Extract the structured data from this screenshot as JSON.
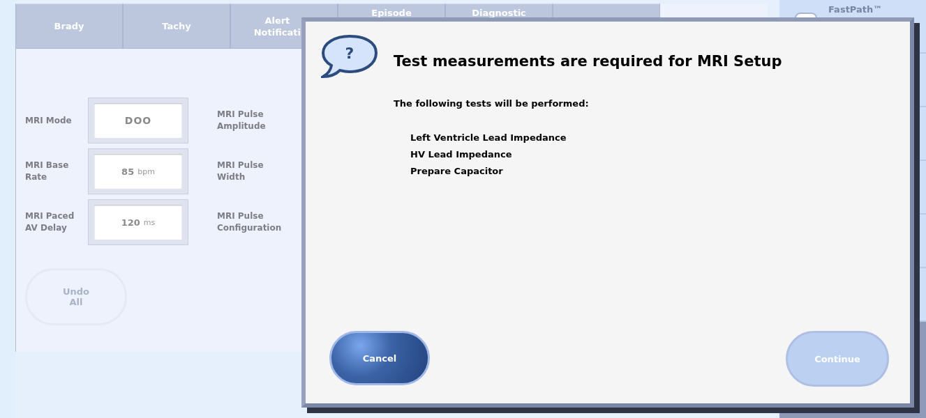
{
  "tabs": [
    {
      "label": "Brady",
      "selected": false
    },
    {
      "label": "Tachy",
      "selected": false
    },
    {
      "label": "Alert Notificati",
      "selected": false
    },
    {
      "label": "Episode",
      "selected": false
    },
    {
      "label": "Diagnostic",
      "selected": false
    },
    {
      "selected": false
    },
    {
      "selected": true
    }
  ],
  "settings": [
    {
      "label": "MRI Mode",
      "value": "DOO",
      "side_label": "MRI Pulse Amplitude"
    },
    {
      "label": "MRI Base Rate",
      "value": "85",
      "unit": "bpm",
      "side_label": "MRI Pulse Width"
    },
    {
      "label": "MRI Paced AV Delay",
      "value": "120",
      "unit": "ms",
      "side_label": "MRI Pulse Configuration"
    }
  ],
  "undo_button": {
    "label": "Undo All",
    "disabled": true
  },
  "sidebar": {
    "items": [
      {
        "label": "FastPath™"
      }
    ]
  },
  "dialog": {
    "icon_mark": "?",
    "title": "Test measurements are required for MRI Setup",
    "subtitle": "The following tests will be performed:",
    "tests": [
      "Left Ventricle Lead Impedance",
      "HV Lead Impedance",
      "Prepare Capacitor"
    ],
    "buttons": [
      {
        "label": "Cancel",
        "disabled": false
      },
      {
        "label": "Continue",
        "disabled": true
      }
    ]
  }
}
